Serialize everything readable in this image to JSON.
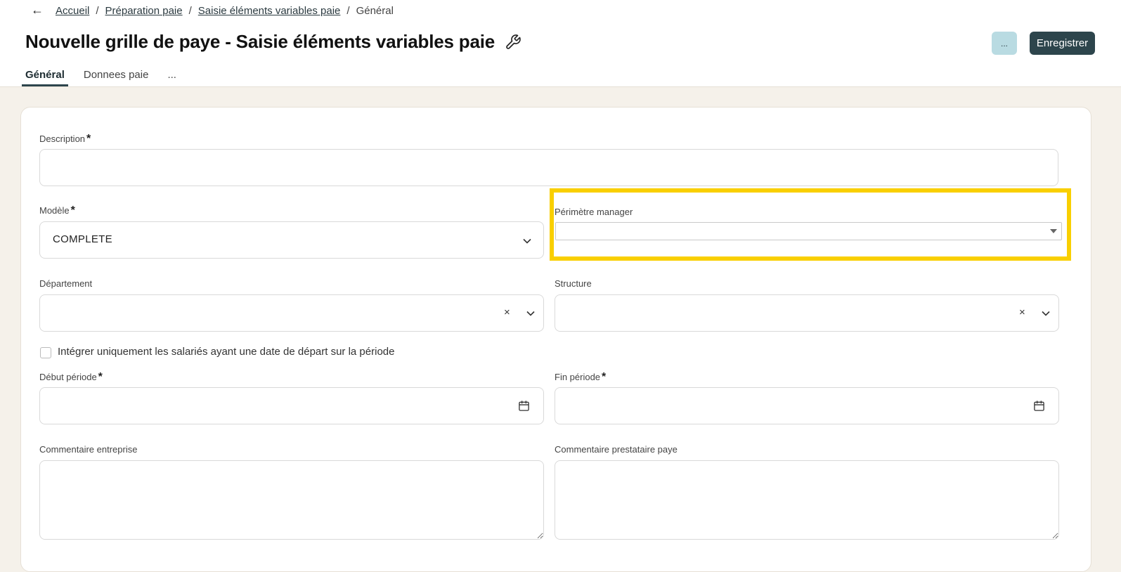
{
  "breadcrumb": {
    "items": [
      "Accueil",
      "Préparation paie",
      "Saisie éléments variables paie"
    ],
    "current": "Général",
    "separator": "/"
  },
  "header": {
    "title": "Nouvelle grille de paye - Saisie éléments variables paie",
    "more_label": "...",
    "save_label": "Enregistrer"
  },
  "tabs": [
    {
      "label": "Général",
      "active": true
    },
    {
      "label": "Donnees paie",
      "active": false
    },
    {
      "label": "...",
      "active": false
    }
  ],
  "form": {
    "description": {
      "label": "Description",
      "required_mark": "*",
      "value": ""
    },
    "modele": {
      "label": "Modèle",
      "required_mark": "*",
      "value": "COMPLETE"
    },
    "perimetre_manager": {
      "label": "Périmètre manager",
      "value": ""
    },
    "departement": {
      "label": "Département",
      "value": "",
      "clear_label": "×"
    },
    "structure": {
      "label": "Structure",
      "value": "",
      "clear_label": "×"
    },
    "checkbox_depart": {
      "label": "Intégrer uniquement les salariés ayant une date de départ sur la période",
      "checked": false
    },
    "debut_periode": {
      "label": "Début période",
      "required_mark": "*",
      "value": ""
    },
    "fin_periode": {
      "label": "Fin période",
      "required_mark": "*",
      "value": ""
    },
    "commentaire_entreprise": {
      "label": "Commentaire entreprise",
      "value": ""
    },
    "commentaire_prestataire": {
      "label": "Commentaire prestataire paye",
      "value": ""
    }
  },
  "colors": {
    "primary": "#2d454c",
    "secondary_button": "#b9dbe2",
    "highlight": "#f9cf00",
    "page_background": "#f5f1ea"
  },
  "icons": [
    "back-arrow-icon",
    "wrench-icon",
    "chevron-down-icon",
    "clear-icon",
    "calendar-icon",
    "dropdown-triangle-icon"
  ]
}
